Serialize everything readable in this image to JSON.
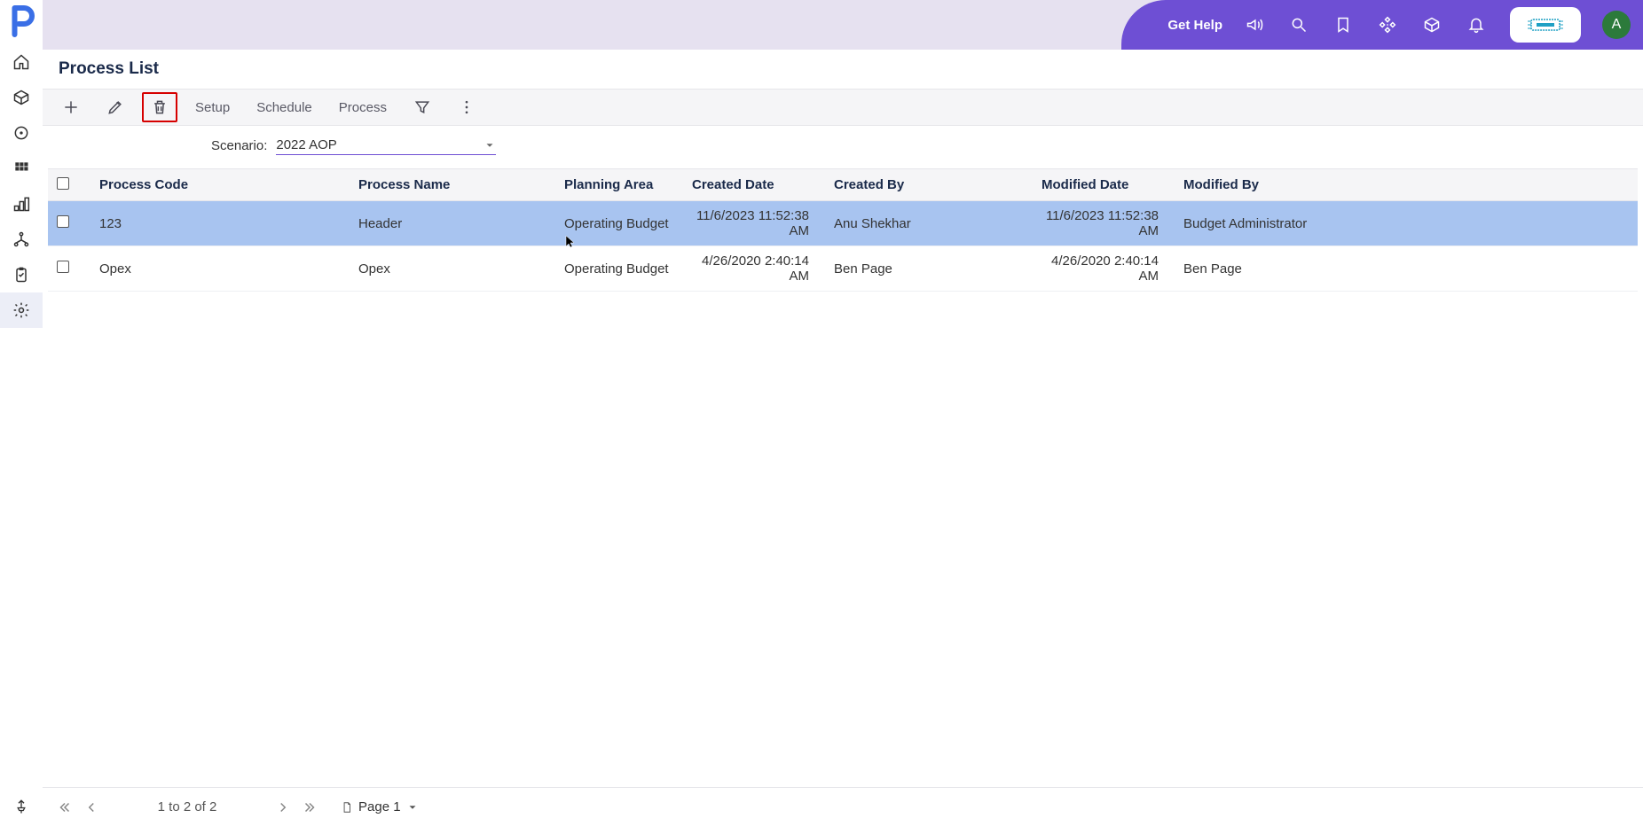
{
  "header": {
    "get_help": "Get Help",
    "avatar_letter": "A"
  },
  "page": {
    "title": "Process List"
  },
  "toolbar": {
    "setup": "Setup",
    "schedule": "Schedule",
    "process": "Process"
  },
  "scenario": {
    "label": "Scenario:",
    "value": "2022 AOP"
  },
  "table": {
    "columns": {
      "process_code": "Process Code",
      "process_name": "Process Name",
      "planning_area": "Planning Area",
      "created_date": "Created Date",
      "created_by": "Created By",
      "modified_date": "Modified Date",
      "modified_by": "Modified By"
    },
    "rows": [
      {
        "selected": true,
        "process_code": "123",
        "process_name": "Header",
        "planning_area": "Operating Budget",
        "created_date": "11/6/2023 11:52:38 AM",
        "created_by": "Anu Shekhar",
        "modified_date": "11/6/2023 11:52:38 AM",
        "modified_by": "Budget Administrator"
      },
      {
        "selected": false,
        "process_code": "Opex",
        "process_name": "Opex",
        "planning_area": "Operating Budget",
        "created_date": "4/26/2020 2:40:14 AM",
        "created_by": "Ben Page",
        "modified_date": "4/26/2020 2:40:14 AM",
        "modified_by": "Ben Page"
      }
    ]
  },
  "pager": {
    "range": "1 to 2 of 2",
    "page_label": "Page 1"
  }
}
